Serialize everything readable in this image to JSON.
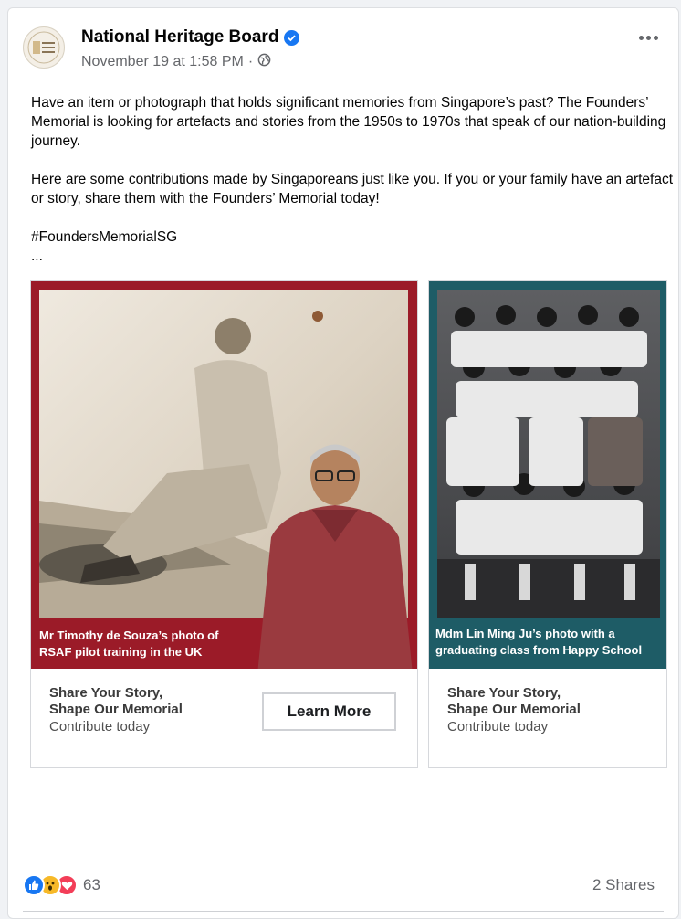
{
  "post": {
    "page_name": "National Heritage Board",
    "timestamp": "November 19 at 1:58 PM",
    "meta_separator": "·",
    "avatar_text": "National Heritage Board",
    "paragraph_1": "Have an item or photograph that holds significant memories from Singapore’s past? The Founders’ Memorial is looking for artefacts and stories from the 1950s to 1970s that speak of our nation-building journey.",
    "paragraph_2": "Here are some contributions made by Singaporeans just like you. If you or your family have an artefact or story, share them with the Founders’ Memorial today!",
    "hashtag": "#FoundersMemorialSG",
    "see_more": "..."
  },
  "cards": [
    {
      "caption": "Mr Timothy de Souza’s photo of RSAF pilot training in the UK",
      "title_line1": "Share Your Story,",
      "title_line2": "Shape Our Memorial",
      "subtitle": "Contribute today",
      "button_label": "Learn More"
    },
    {
      "caption": "Mdm Lin Ming Ju’s photo with a graduating class from Happy School",
      "title_line1": "Share Your Story,",
      "title_line2": "Shape Our Memorial",
      "subtitle": "Contribute today"
    }
  ],
  "footer": {
    "reaction_count": "63",
    "shares": "2 Shares"
  },
  "icons": {
    "verified": "verified-badge-icon",
    "privacy": "globe-icon",
    "more": "more-options-icon",
    "like": "like-reaction-icon",
    "wow": "wow-reaction-icon",
    "love": "love-reaction-icon"
  },
  "colors": {
    "card1_frame": "#9b1b28",
    "card2_frame": "#1e5c66",
    "link_blue": "#1877f2"
  }
}
